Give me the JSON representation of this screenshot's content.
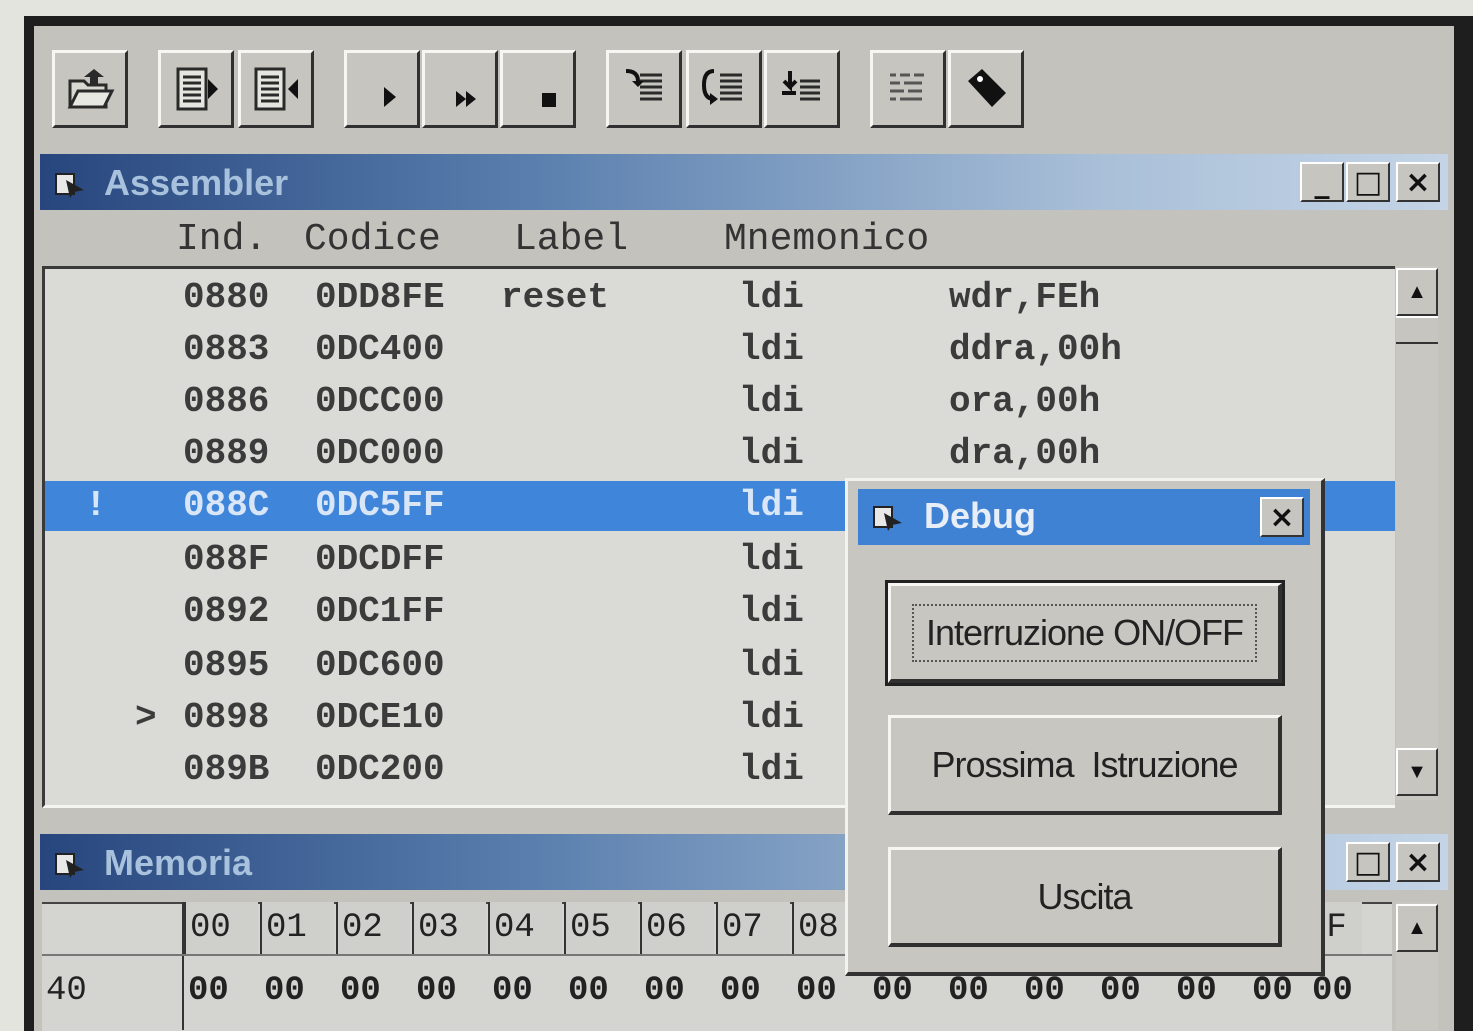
{
  "assembler": {
    "title": "Assembler",
    "controls": {
      "minimize": "_",
      "maximize": "□",
      "close": "×"
    },
    "headers": {
      "ind": "Ind.",
      "codice": "Codice",
      "label": "Label",
      "mnemonico": "Mnemonico"
    },
    "rows": [
      {
        "marker": "",
        "ind": "0880",
        "codice": "0DD8FE",
        "label": "reset",
        "mnem": "ldi",
        "operand": "wdr,FEh"
      },
      {
        "marker": "",
        "ind": "0883",
        "codice": "0DC400",
        "label": "",
        "mnem": "ldi",
        "operand": "ddra,00h"
      },
      {
        "marker": "",
        "ind": "0886",
        "codice": "0DCC00",
        "label": "",
        "mnem": "ldi",
        "operand": "ora,00h"
      },
      {
        "marker": "",
        "ind": "0889",
        "codice": "0DC000",
        "label": "",
        "mnem": "ldi",
        "operand": "dra,00h"
      },
      {
        "marker": "!",
        "ind": "088C",
        "codice": "0DC5FF",
        "label": "",
        "mnem": "ldi",
        "operand": ""
      },
      {
        "marker": "",
        "ind": "088F",
        "codice": "0DCDFF",
        "label": "",
        "mnem": "ldi",
        "operand": ""
      },
      {
        "marker": "",
        "ind": "0892",
        "codice": "0DC1FF",
        "label": "",
        "mnem": "ldi",
        "operand": ""
      },
      {
        "marker": "",
        "ind": "0895",
        "codice": "0DC600",
        "label": "",
        "mnem": "ldi",
        "operand": ""
      },
      {
        "marker": ">",
        "ind": "0898",
        "codice": "0DCE10",
        "label": "",
        "mnem": "ldi",
        "operand": ""
      },
      {
        "marker": "",
        "ind": "089B",
        "codice": "0DC200",
        "label": "",
        "mnem": "ldi",
        "operand": ""
      }
    ],
    "selected_row": 4
  },
  "memoria": {
    "title": "Memoria",
    "controls": {
      "maximize": "□",
      "close": "×"
    },
    "columns": [
      "00",
      "01",
      "02",
      "03",
      "04",
      "05",
      "06",
      "07",
      "08",
      "0F"
    ],
    "address": "40",
    "values": [
      "00",
      "00",
      "00",
      "00",
      "00",
      "00",
      "00",
      "00",
      "00",
      "00",
      "00",
      "00",
      "00",
      "00",
      "00",
      "00"
    ]
  },
  "debug": {
    "title": "Debug",
    "close": "×",
    "buttons": {
      "interruzione": "Interruzione ON/OFF",
      "prossima": "Prossima  Istruzione",
      "uscita": "Uscita"
    }
  },
  "toolbar": {
    "icons": [
      "open-folder-icon",
      "step-into-icon",
      "step-out-icon",
      "play-icon",
      "fast-forward-icon",
      "stop-icon",
      "breakpoint-icon",
      "jump-icon",
      "step-over-icon",
      "list-icon",
      "tag-icon"
    ]
  },
  "colors": {
    "selection": "#3f86da",
    "title_active": "#3f82d4",
    "face": "#c3c2bd"
  }
}
